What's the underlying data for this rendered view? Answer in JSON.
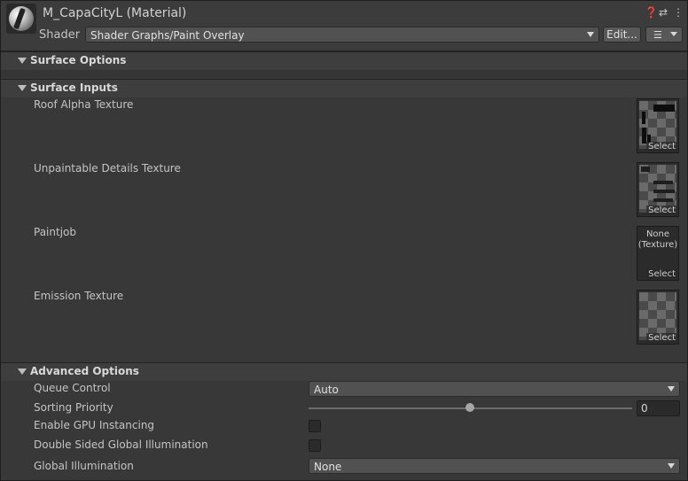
{
  "header": {
    "title": "M_CapaCityL (Material)",
    "icons": [
      "help-icon",
      "preset-icon",
      "kebab-menu-icon"
    ],
    "shader_label": "Shader",
    "shader_value": "Shader Graphs/Paint Overlay",
    "edit_label": "Edit..."
  },
  "sections": {
    "surface_options": "Surface Options",
    "surface_inputs": "Surface Inputs",
    "advanced_options": "Advanced Options"
  },
  "textures": [
    {
      "label": "Roof Alpha Texture",
      "select": "Select"
    },
    {
      "label": "Unpaintable Details Texture",
      "select": "Select"
    },
    {
      "label": "Paintjob",
      "select": "Select",
      "none_line1": "None",
      "none_line2": "(Texture)"
    },
    {
      "label": "Emission Texture",
      "select": "Select"
    }
  ],
  "advanced": {
    "queue_control_label": "Queue Control",
    "queue_control_value": "Auto",
    "sorting_priority_label": "Sorting Priority",
    "sorting_priority_value": "0",
    "gpu_instancing_label": "Enable GPU Instancing",
    "gpu_instancing_checked": false,
    "double_sided_gi_label": "Double Sided Global Illumination",
    "double_sided_gi_checked": false,
    "global_illumination_label": "Global Illumination",
    "global_illumination_value": "None"
  }
}
